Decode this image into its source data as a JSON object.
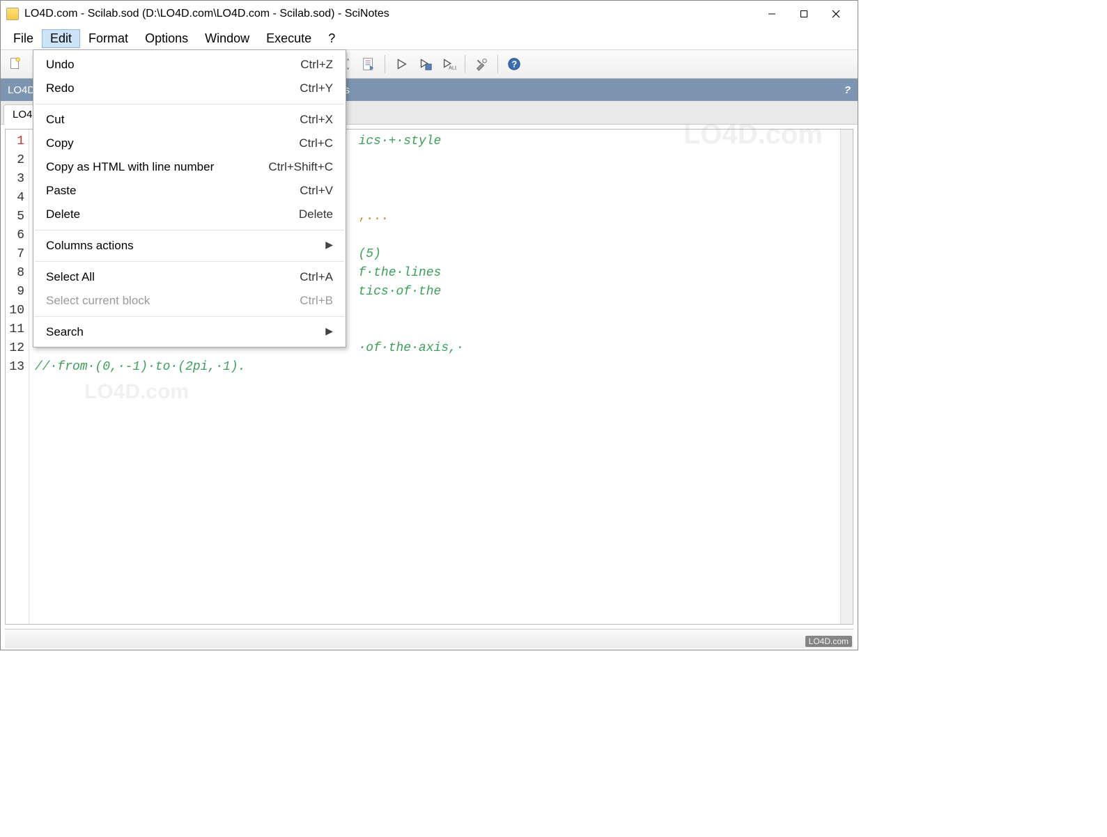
{
  "window": {
    "title": "LO4D.com - Scilab.sod (D:\\LO4D.com\\LO4D.com - Scilab.sod) - SciNotes"
  },
  "menubar": {
    "items": [
      "File",
      "Edit",
      "Format",
      "Options",
      "Window",
      "Execute",
      "?"
    ],
    "open_index": 1
  },
  "dropdown": {
    "groups": [
      [
        {
          "label": "Undo",
          "shortcut": "Ctrl+Z"
        },
        {
          "label": "Redo",
          "shortcut": "Ctrl+Y"
        }
      ],
      [
        {
          "label": "Cut",
          "shortcut": "Ctrl+X"
        },
        {
          "label": "Copy",
          "shortcut": "Ctrl+C"
        },
        {
          "label": "Copy as HTML with line number",
          "shortcut": "Ctrl+Shift+C"
        },
        {
          "label": "Paste",
          "shortcut": "Ctrl+V"
        },
        {
          "label": "Delete",
          "shortcut": "Delete"
        }
      ],
      [
        {
          "label": "Columns actions",
          "submenu": true
        }
      ],
      [
        {
          "label": "Select All",
          "shortcut": "Ctrl+A"
        },
        {
          "label": "Select current block",
          "shortcut": "Ctrl+B",
          "disabled": true
        }
      ],
      [
        {
          "label": "Search",
          "submenu": true
        }
      ]
    ]
  },
  "subheader": {
    "text": "LO4D.com - Scilab.sod (D:\\LO4D.com\\LO4D.com - Scilab.sod) - SciNotes",
    "help": "?"
  },
  "tab": {
    "label": "LO4D.com - Scilab.sod"
  },
  "editor": {
    "line_count": 13,
    "current_line": 1,
    "visible_fragments": {
      "l1": "ics·+·style",
      "l5": ",...",
      "l7": "(5)",
      "l8": "f·the·lines",
      "l9": "tics·of·the",
      "l12": "·of·the·axis,·",
      "l13": "//·from·(0,·-1)·to·(2pi,·1)."
    }
  },
  "watermarks": {
    "main": "LO4D.com",
    "small": "LO4D.com",
    "corner": "LO4D.com"
  }
}
